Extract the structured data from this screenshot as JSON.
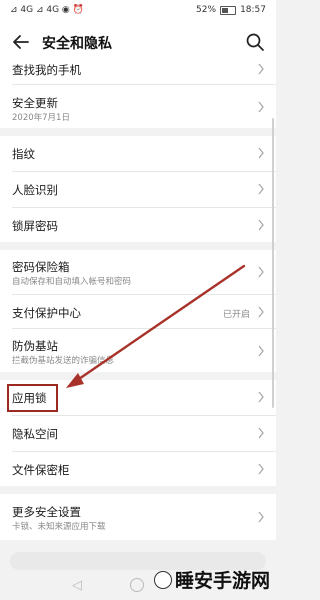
{
  "status_bar": {
    "left_icons": "⊿ 4G ⊿ 4G ◉ ⏰",
    "battery": "52%",
    "time": "18:57"
  },
  "header": {
    "title": "安全和隐私",
    "back_icon": "arrow-left",
    "search_icon": "search"
  },
  "groups": [
    {
      "rows": [
        {
          "label": "查找我的手机"
        },
        {
          "label": "安全更新",
          "sub": "2020年7月1日"
        }
      ]
    },
    {
      "rows": [
        {
          "label": "指纹"
        },
        {
          "label": "人脸识别"
        },
        {
          "label": "锁屏密码"
        }
      ]
    },
    {
      "rows": [
        {
          "label": "密码保险箱",
          "sub": "自动保存和自动填入帐号和密码"
        },
        {
          "label": "支付保护中心",
          "value": "已开启"
        },
        {
          "label": "防伪基站",
          "sub": "拦截伪基站发送的诈骗信息"
        }
      ]
    },
    {
      "rows": [
        {
          "label": "应用锁"
        },
        {
          "label": "隐私空间"
        },
        {
          "label": "文件保密柜"
        }
      ]
    },
    {
      "rows": [
        {
          "label": "更多安全设置",
          "sub": "卡锁、未知来源应用下载"
        }
      ]
    }
  ],
  "annotation": {
    "color": "#a8322a",
    "highlight": "应用锁"
  },
  "watermark": {
    "text": "睡安手游网"
  },
  "colors": {
    "background": "#f2f2f2",
    "card": "#ffffff",
    "annotation": "#a8322a"
  }
}
